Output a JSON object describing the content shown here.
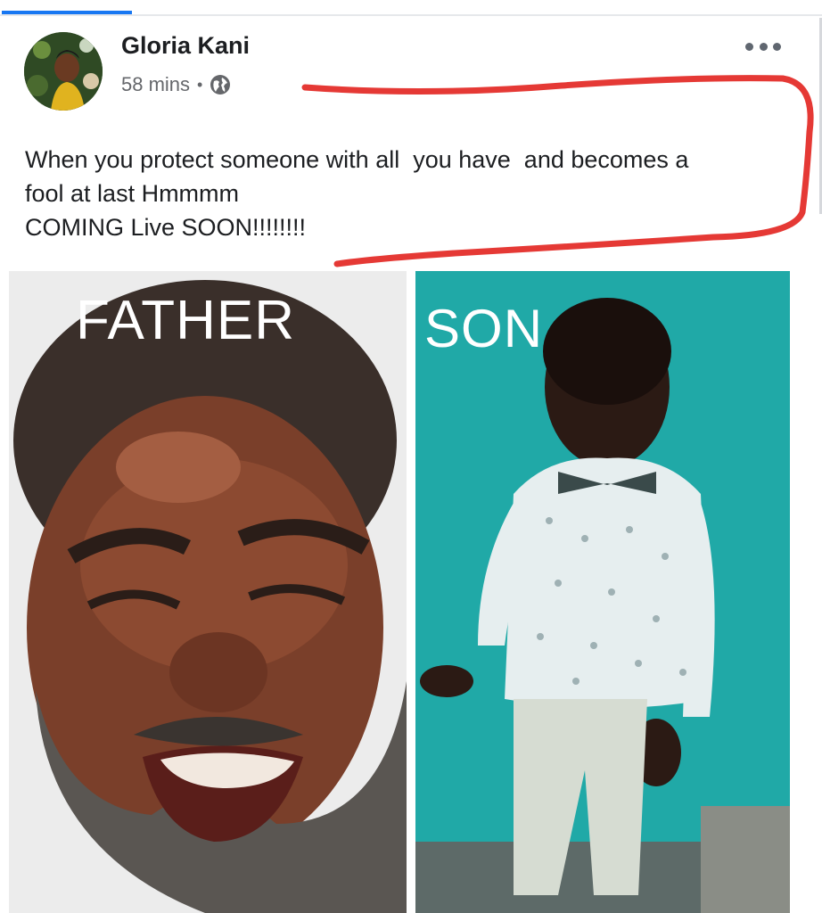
{
  "post": {
    "author": "Gloria Kani",
    "time": "58 mins",
    "separator": "•",
    "text_line1": "When you protect someone with all  you have  and becomes a",
    "text_line2": "fool at last Hmmmm",
    "text_line3": "COMING Live SOON!!!!!!!!"
  },
  "images": {
    "left_caption": "FATHER",
    "right_caption": "SON"
  },
  "icons": {
    "privacy": "globe-icon",
    "menu": "more-options-icon"
  },
  "colors": {
    "accent": "#1877f2",
    "annotation": "#e53935",
    "son_background": "#1fa6a4"
  }
}
